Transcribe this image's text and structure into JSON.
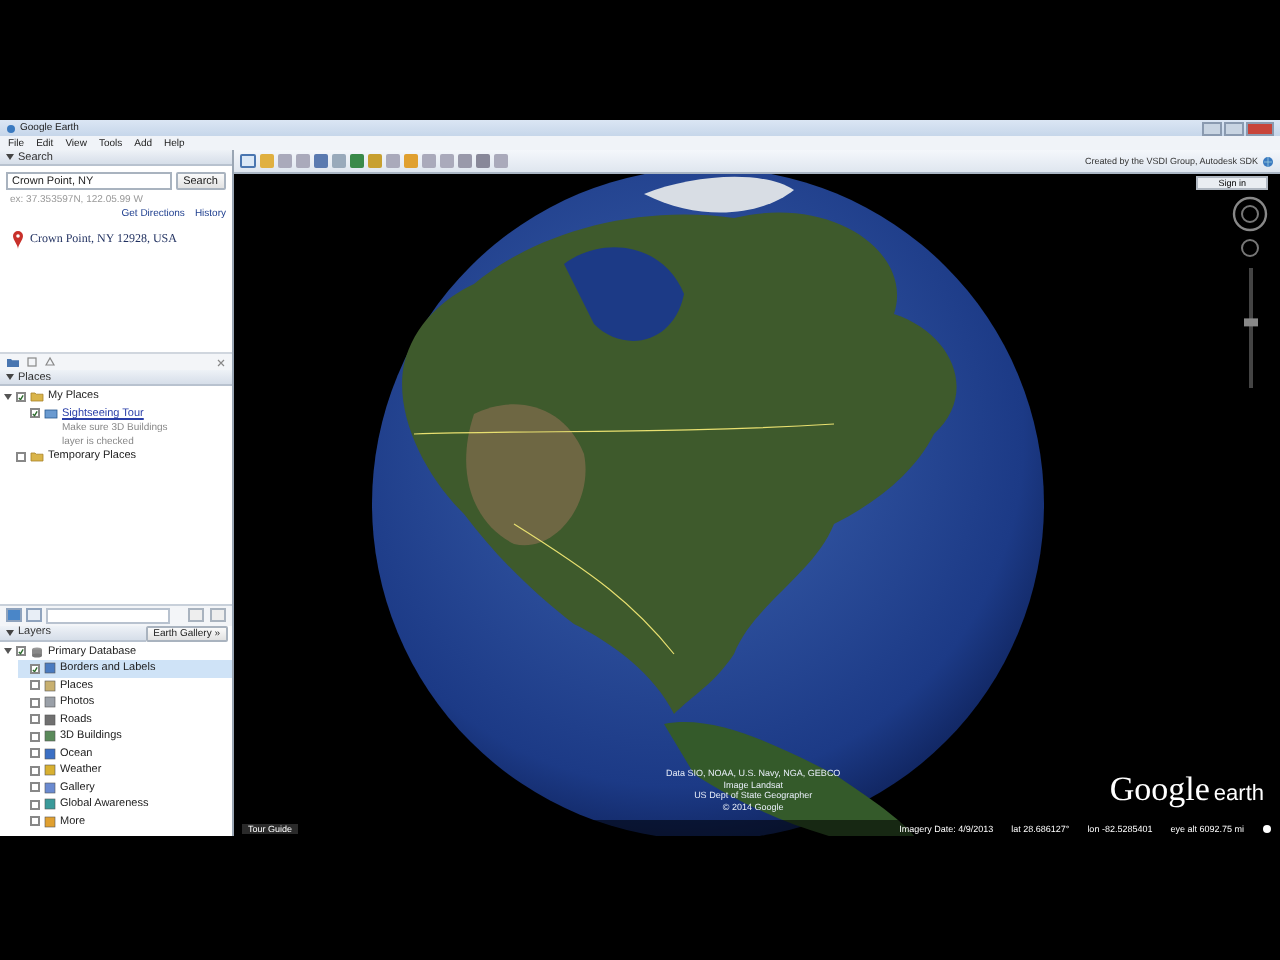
{
  "window": {
    "title": "Google Earth"
  },
  "menu": [
    "File",
    "Edit",
    "View",
    "Tools",
    "Add",
    "Help"
  ],
  "search": {
    "header": "Search",
    "value": "Crown Point, NY",
    "button": "Search",
    "hint": "ex: 37.353597N, 122.05.99 W",
    "links": [
      "Get Directions",
      "History"
    ],
    "result": "Crown Point, NY 12928, USA"
  },
  "places": {
    "header": "Places",
    "items": [
      {
        "label": "My Places",
        "checked": true,
        "expanded": true,
        "kind": "folder",
        "children": [
          {
            "label": "Sightseeing Tour",
            "checked": true,
            "kind": "tour",
            "description": [
              "Make sure 3D Buildings",
              "layer is checked"
            ]
          }
        ]
      },
      {
        "label": "Temporary Places",
        "checked": false,
        "kind": "folder"
      }
    ]
  },
  "layers": {
    "header": "Layers",
    "gallery_button": "Earth Gallery »",
    "items": [
      {
        "label": "Primary Database",
        "checked": true,
        "expanded": true,
        "selected": false,
        "kind": "database",
        "children": [
          {
            "label": "Borders and Labels",
            "checked": true,
            "selected": true,
            "kind": "layer",
            "color": "#4a7bc0"
          },
          {
            "label": "Places",
            "checked": false,
            "selected": false,
            "kind": "layer",
            "color": "#c8b070"
          },
          {
            "label": "Photos",
            "checked": false,
            "selected": false,
            "kind": "layer",
            "color": "#9aa0a8"
          },
          {
            "label": "Roads",
            "checked": false,
            "selected": false,
            "kind": "layer",
            "color": "#707070"
          },
          {
            "label": "3D Buildings",
            "checked": false,
            "selected": false,
            "kind": "layer",
            "color": "#5a8a5a"
          },
          {
            "label": "Ocean",
            "checked": false,
            "selected": false,
            "kind": "layer",
            "color": "#3b6fc4"
          },
          {
            "label": "Weather",
            "checked": false,
            "selected": false,
            "kind": "layer",
            "color": "#d8b030"
          },
          {
            "label": "Gallery",
            "checked": false,
            "selected": false,
            "kind": "layer",
            "color": "#6a8ad0"
          },
          {
            "label": "Global Awareness",
            "checked": false,
            "selected": false,
            "kind": "layer",
            "color": "#3a9a9a"
          },
          {
            "label": "More",
            "checked": false,
            "selected": false,
            "kind": "layer",
            "color": "#e0a030"
          }
        ]
      }
    ]
  },
  "map": {
    "credit": "Created by the VSDI Group, Autodesk SDK",
    "sign_in": "Sign in",
    "attribution": [
      "Data SIO, NOAA, U.S. Navy, NGA, GEBCO",
      "Image Landsat",
      "US Dept of State Geographer",
      "© 2014 Google"
    ],
    "zoom": {
      "level": 0.55
    },
    "logo": {
      "brand": "Google",
      "product": "earth"
    },
    "tour_guide": "Tour Guide",
    "status": {
      "imagery_date": "Imagery Date: 4/9/2013",
      "lat": "lat  28.686127°",
      "lon": "lon  -82.5285401",
      "eye_alt": "eye alt 6092.75 mi"
    }
  }
}
